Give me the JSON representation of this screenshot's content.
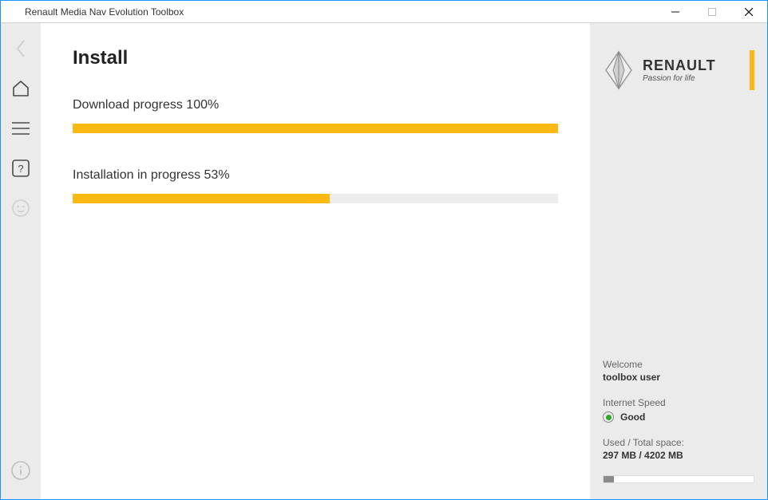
{
  "window": {
    "title": "Renault Media Nav Evolution Toolbox"
  },
  "main": {
    "heading": "Install",
    "download": {
      "label": "Download progress 100%",
      "percent": 100
    },
    "install": {
      "label": "Installation in progress 53%",
      "percent": 53
    }
  },
  "brand": {
    "name": "RENAULT",
    "tagline": "Passion for life"
  },
  "right": {
    "welcome_label": "Welcome",
    "username": "toolbox user",
    "speed_label": "Internet Speed",
    "speed_value": "Good",
    "space_label": "Used / Total space:",
    "space_value": "297 MB / 4202 MB",
    "space_used": 297,
    "space_total": 4202
  },
  "colors": {
    "accent": "#fdb913"
  }
}
